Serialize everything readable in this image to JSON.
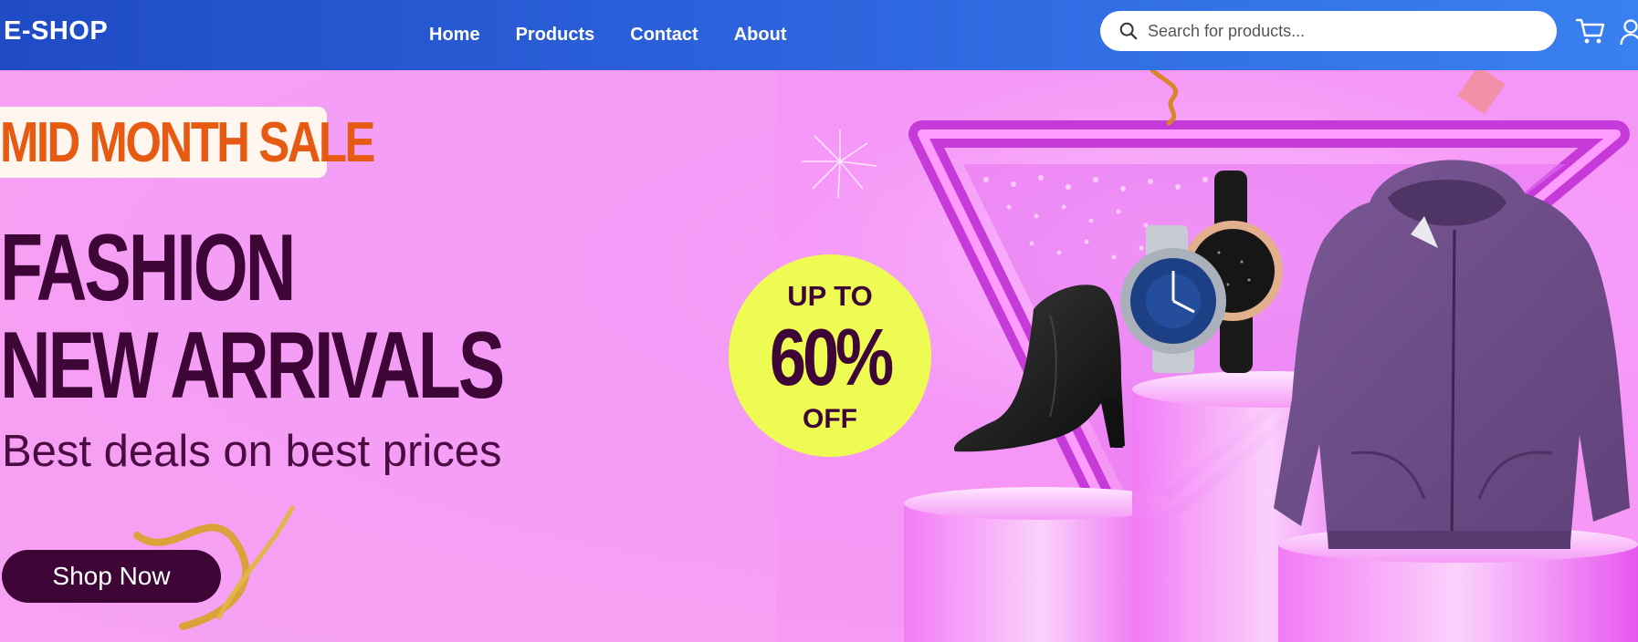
{
  "brand": {
    "logo_text": "E-SHOP"
  },
  "nav": {
    "links": [
      {
        "label": "Home"
      },
      {
        "label": "Products"
      },
      {
        "label": "Contact"
      },
      {
        "label": "About"
      }
    ]
  },
  "search": {
    "placeholder": "Search for products...",
    "value": ""
  },
  "header_icons": [
    "search-icon",
    "cart-icon",
    "user-icon"
  ],
  "hero": {
    "sale_tag": "MID MONTH SALE",
    "headline_line1": "FASHION",
    "headline_line2": "NEW ARRIVALS",
    "subtitle": "Best deals on best prices",
    "cta_label": "Shop Now",
    "discount": {
      "line1": "UP TO",
      "line2": "60%",
      "line3": "OFF"
    },
    "products": [
      "boot",
      "watches",
      "hoodie"
    ]
  },
  "colors": {
    "nav_start": "#1f4bc4",
    "nav_end": "#3a80f0",
    "hero_bg": "#f59ef5",
    "sale_orange": "#e65a12",
    "headline_plum": "#3d0637",
    "badge_yellow": "#edfb52",
    "podium_magenta": "#e34df0"
  }
}
